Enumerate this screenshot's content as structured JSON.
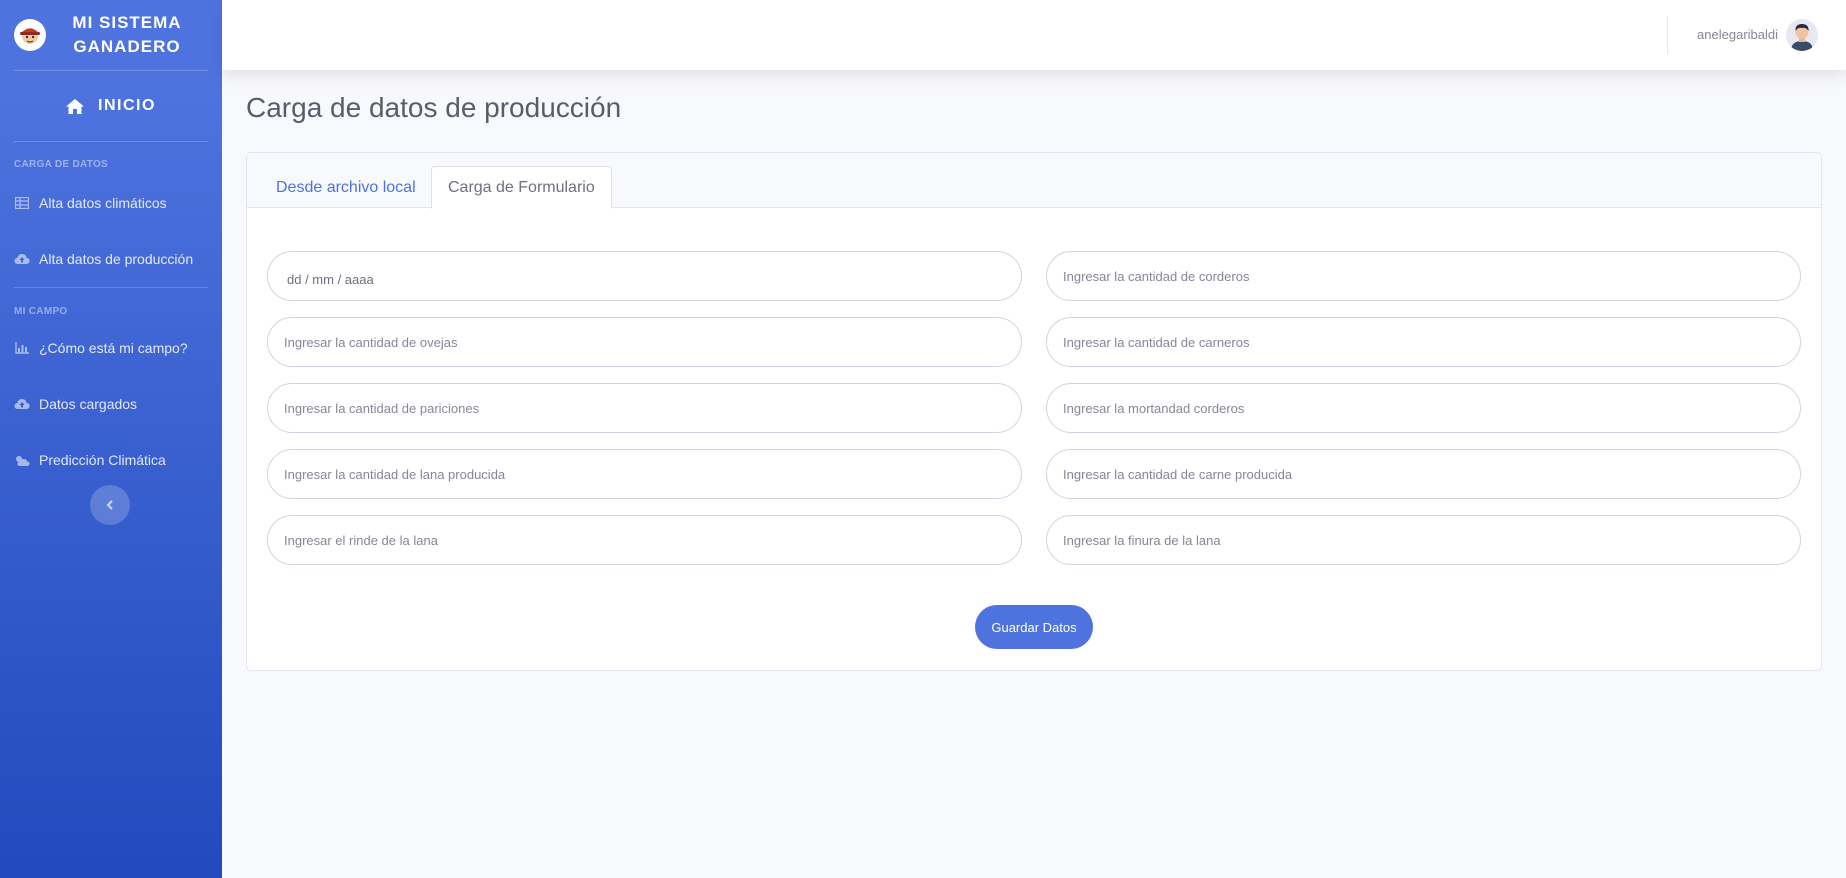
{
  "sidebar": {
    "brand": "MI SISTEMA GANADERO",
    "home_label": "INICIO",
    "section_data_heading": "CARGA DE DATOS",
    "section_data_items": [
      {
        "label": "Alta datos climáticos",
        "icon": "table-icon"
      },
      {
        "label": "Alta datos de producción",
        "icon": "cloud-upload-icon"
      }
    ],
    "section_field_heading": "MI CAMPO",
    "section_field_items": [
      {
        "label": "¿Cómo está mi campo?",
        "icon": "chart-area-icon"
      },
      {
        "label": "Datos cargados",
        "icon": "cloud-upload-icon"
      },
      {
        "label": "Predicción Climática",
        "icon": "cloud-sun-icon"
      }
    ]
  },
  "topbar": {
    "username": "anelegaribaldi"
  },
  "main": {
    "title": "Carga de datos de producción",
    "tabs": [
      {
        "label": "Desde archivo local",
        "active": false
      },
      {
        "label": "Carga de Formulario",
        "active": true
      }
    ],
    "form": {
      "date_placeholder": "dd / mm / aaaa",
      "left_fields": [
        "Ingresar la cantidad de ovejas",
        "Ingresar la cantidad de pariciones",
        "Ingresar la cantidad de lana producida",
        "Ingresar el rinde de la lana"
      ],
      "right_fields": [
        "Ingresar la cantidad de corderos",
        "Ingresar la cantidad de carneros",
        "Ingresar la mortandad corderos",
        "Ingresar la cantidad de carne producida",
        "Ingresar la finura de la lana"
      ],
      "submit_label": "Guardar Datos"
    }
  },
  "colors": {
    "primary": "#4e73df",
    "primary_dark": "#224abe",
    "background": "#f8f9fc"
  }
}
